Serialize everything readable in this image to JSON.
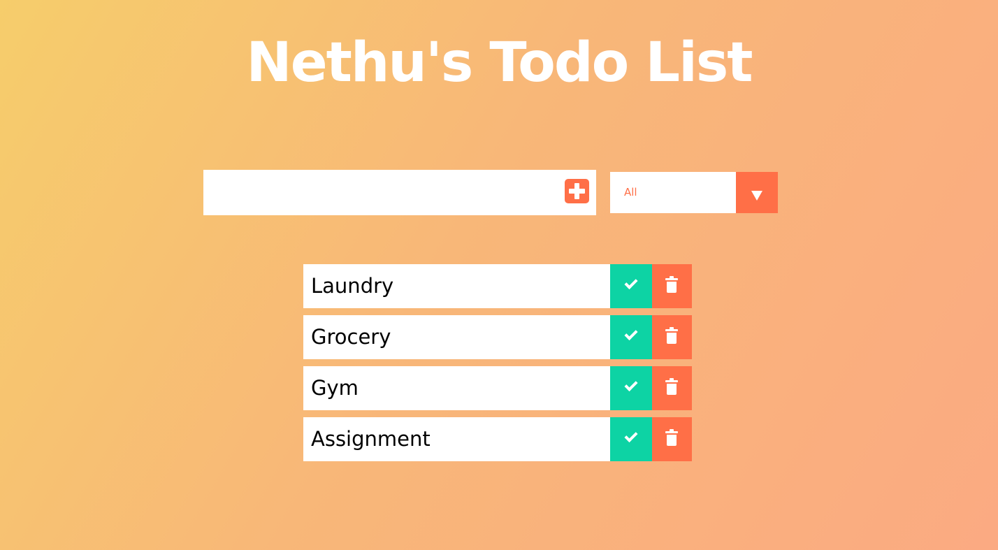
{
  "header": {
    "title": "Nethu's Todo List"
  },
  "form": {
    "input_value": "",
    "add_icon": "plus-square-icon",
    "filter_selected": "All",
    "filter_arrow_icon": "caret-down-icon"
  },
  "todos": [
    {
      "text": "Laundry"
    },
    {
      "text": "Grocery"
    },
    {
      "text": "Gym"
    },
    {
      "text": "Assignment"
    }
  ],
  "icons": {
    "complete": "check-icon",
    "delete": "trash-icon"
  },
  "colors": {
    "accent": "#ff6f47",
    "complete": "#0dd3a4",
    "gradient_start": "#f6cd6b",
    "gradient_end": "#fbaa82"
  }
}
